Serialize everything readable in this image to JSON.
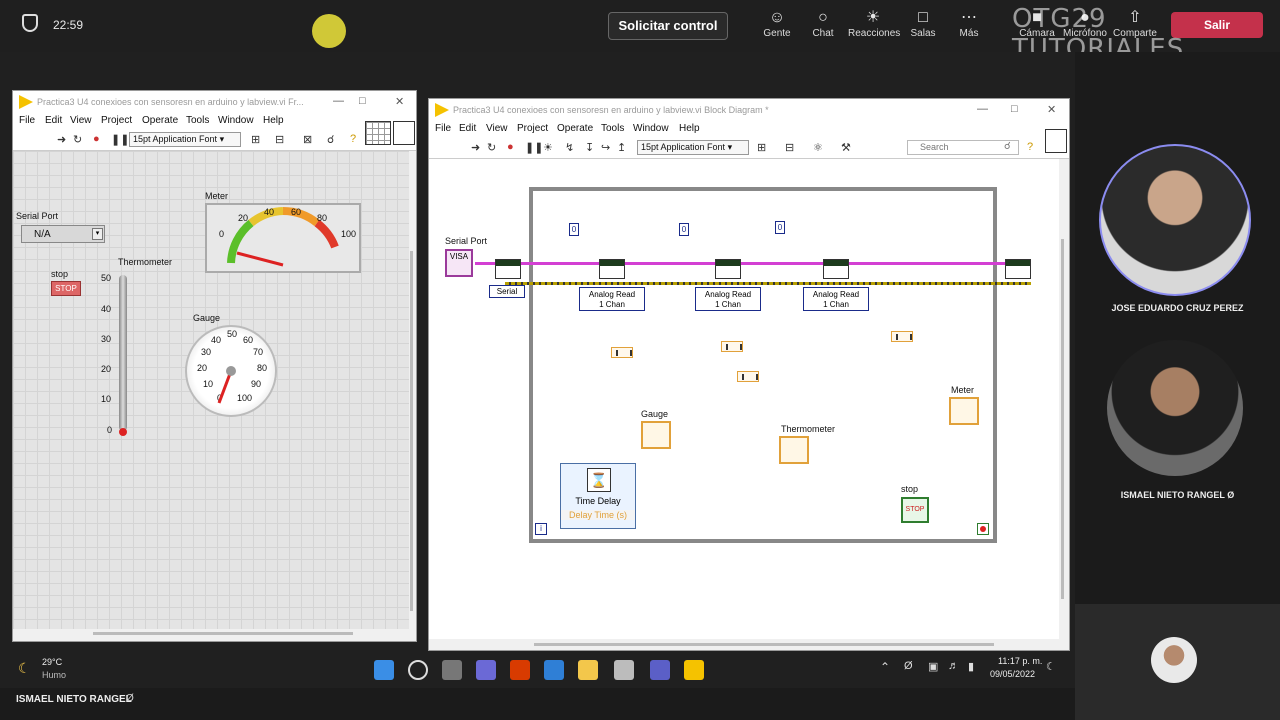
{
  "teams": {
    "time": "22:59",
    "request_control": "Solicitar control",
    "buttons": [
      {
        "label": "Gente",
        "icon": "people-icon"
      },
      {
        "label": "Chat",
        "icon": "chat-icon"
      },
      {
        "label": "Reacciones",
        "icon": "reactions-icon"
      },
      {
        "label": "Salas",
        "icon": "rooms-icon"
      },
      {
        "label": "Más",
        "icon": "more-icon"
      },
      {
        "label": "Cámara",
        "icon": "camera-off-icon"
      },
      {
        "label": "Micrófono",
        "icon": "mic-off-icon"
      },
      {
        "label": "Comparte",
        "icon": "share-icon"
      }
    ],
    "leave": "Salir",
    "watermark": "OTG29 TUTORIALES",
    "participants": [
      "JOSE EDUARDO CRUZ PEREZ",
      "ISMAEL NIETO RANGEL"
    ],
    "presenter_footer": "ISMAEL NIETO RANGEL",
    "accent": "#c4314b"
  },
  "front_panel": {
    "title": "Practica3 U4 conexioes con sensoresn en arduino y labview.vi Fr...",
    "menu": [
      "File",
      "Edit",
      "View",
      "Project",
      "Operate",
      "Tools",
      "Window",
      "Help"
    ],
    "font": "15pt Application Font",
    "serial_port_label": "Serial Port",
    "serial_port_value": "N/A",
    "stop_label": "stop",
    "stop_button": "STOP",
    "thermometer_label": "Thermometer",
    "thermo_ticks": [
      "50",
      "40",
      "30",
      "20",
      "10",
      "0"
    ],
    "meter_label": "Meter",
    "meter_ticks": [
      "0",
      "20",
      "40",
      "60",
      "80",
      "100"
    ],
    "gauge_label": "Gauge",
    "gauge_ticks": [
      "0",
      "10",
      "20",
      "30",
      "40",
      "50",
      "60",
      "70",
      "80",
      "90",
      "100"
    ]
  },
  "block_diagram": {
    "title": "Practica3 U4 conexioes con sensoresn en arduino y labview.vi Block Diagram *",
    "menu": [
      "File",
      "Edit",
      "View",
      "Project",
      "Operate",
      "Tools",
      "Window",
      "Help"
    ],
    "font": "15pt Application Font",
    "search_placeholder": "Search",
    "serial_port_label": "Serial Port",
    "visa": "VISA",
    "serial_sel": "Serial",
    "zero": "0",
    "analog_read": [
      "Analog Read",
      "1 Chan"
    ],
    "gauge": "Gauge",
    "thermometer": "Thermometer",
    "meter": "Meter",
    "time_delay": "Time Delay",
    "delay_time": "Delay Time (s)",
    "stop": "stop",
    "stop_term": "STOP",
    "loop_info": "i"
  },
  "taskbar": {
    "weather_temp": "29°C",
    "weather_desc": "Humo",
    "clock_time": "11:17 p. m.",
    "clock_date": "09/05/2022"
  }
}
